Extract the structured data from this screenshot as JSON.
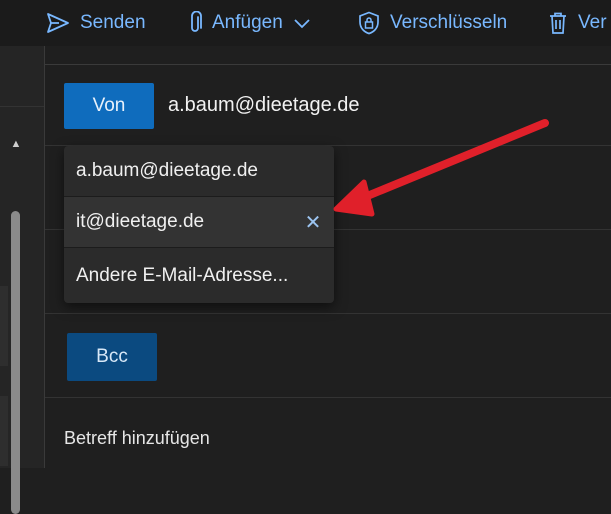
{
  "toolbar": {
    "send_label": "Senden",
    "attach_label": "Anfügen",
    "encrypt_label": "Verschlüsseln",
    "delete_label": "Ver"
  },
  "compose": {
    "from_label": "Von",
    "from_value": "a.baum@dieetage.de",
    "from_dropdown": {
      "items": [
        {
          "label": "a.baum@dieetage.de"
        },
        {
          "label": "it@dieetage.de",
          "remove_glyph": "✕"
        },
        {
          "label": "Andere E-Mail-Adresse..."
        }
      ]
    },
    "bcc_label": "Bcc",
    "subject_placeholder": "Betreff hinzufügen"
  },
  "annotation": {
    "color": "#e0202a",
    "icon": "arrow-annotation"
  },
  "colors": {
    "accent": "#0f6cbd",
    "link": "#79b8ff"
  }
}
